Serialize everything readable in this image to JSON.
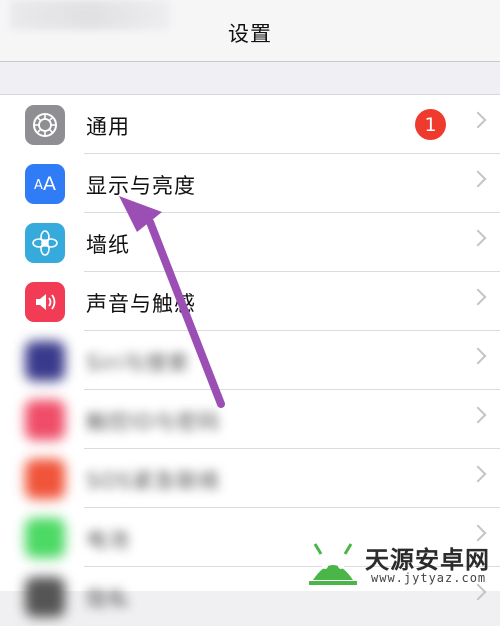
{
  "navbar": {
    "title": "设置"
  },
  "settings": {
    "items": [
      {
        "label": "通用",
        "icon": "gear-icon",
        "color": "#8e8e93",
        "badge": "1"
      },
      {
        "label": "显示与亮度",
        "icon": "text-size-icon",
        "icon_text": "AA",
        "color": "#2f7cf6"
      },
      {
        "label": "墙纸",
        "icon": "flower-icon",
        "color": "#36aadc"
      },
      {
        "label": "声音与触感",
        "icon": "speaker-icon",
        "color": "#f23b55"
      },
      {
        "label": "Siri与搜索",
        "icon": "siri-icon",
        "color": "#3a3a8c"
      },
      {
        "label": "触控ID与密码",
        "icon": "fingerprint-icon",
        "color": "#ef4d68"
      },
      {
        "label": "SOS紧急联络",
        "icon": "sos-icon",
        "color": "#f0543a"
      },
      {
        "label": "电池",
        "icon": "battery-icon",
        "color": "#4cd964"
      },
      {
        "label": "隐私",
        "icon": "hand-icon",
        "color": "#555555"
      }
    ]
  },
  "watermark": {
    "title": "天源安卓网",
    "url": "www.jytyaz.com"
  },
  "colors": {
    "badge": "#ef3b2e",
    "arrow": "#9b4fb5"
  }
}
